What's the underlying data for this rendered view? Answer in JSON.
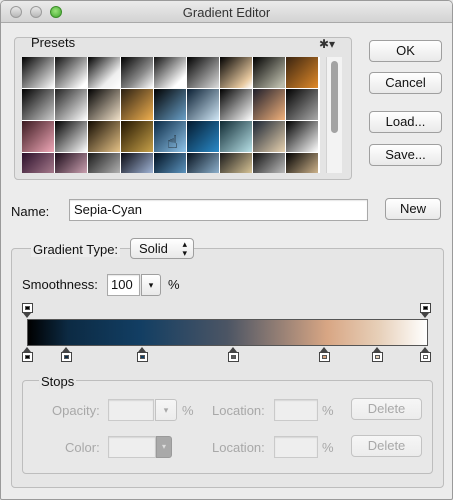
{
  "window": {
    "title": "Gradient Editor"
  },
  "presets": {
    "label": "Presets",
    "menu_icon": "gear-icon",
    "swatches": [
      "linear-gradient(135deg,#000 0%,#fff 100%)",
      "linear-gradient(135deg,#111 0%,#fff 90%)",
      "linear-gradient(135deg,#000 0%,#eee 70%,#fff 100%)",
      "linear-gradient(135deg,#000 0%,#888 60%,#fff 100%)",
      "linear-gradient(135deg,#111 0%,#fff 80%)",
      "linear-gradient(135deg,#000 0%,#ddd 100%)",
      "linear-gradient(135deg,#000 0%,#e8c9a0 80%,#fff 100%)",
      "linear-gradient(135deg,#000 0%,#bba 90%)",
      "linear-gradient(135deg,#3a2410 0%,#e08a2a 100%)",
      "linear-gradient(135deg,#000 0%,#ccc 100%)",
      "linear-gradient(135deg,#222 0%,#fff 100%)",
      "linear-gradient(135deg,#000 0%,#f0e0c8 100%)",
      "linear-gradient(135deg,#2a1f12 0%,#f0b050 100%)",
      "linear-gradient(135deg,#000 0%,#6aa0c8 100%)",
      "linear-gradient(135deg,#0a1f33 0%,#cfe6f5 100%)",
      "linear-gradient(135deg,#000 0%,#ffffff 100%)",
      "linear-gradient(135deg,#1d1d2a 0%,#f2b27c 100%)",
      "linear-gradient(135deg,#000 0%,#aaa 100%)",
      "linear-gradient(135deg,#3b1a20 0%,#f0a8b8 100%)",
      "linear-gradient(135deg,#000 0%,#fff 100%)",
      "linear-gradient(135deg,#120a00 0%,#e5c287 100%)",
      "linear-gradient(135deg,#221500 0%,#c7a14a 100%)",
      "linear-gradient(135deg,#0b2a45 0%,#8fc4ea 100%)",
      "linear-gradient(135deg,#041a2e 0%,#2a8ac8 100%)",
      "linear-gradient(135deg,#0f2a33 0%,#b7e0e6 100%)",
      "linear-gradient(135deg,#1a2433 0%,#e8d2b0 100%)",
      "linear-gradient(135deg,#000 0%,#fff 100%)",
      "linear-gradient(135deg,#2a0f2a 0%,#c090a0 100%)",
      "linear-gradient(135deg,#1a0a18 0%,#f0c0d0 100%)",
      "linear-gradient(135deg,#1a1a1a 0%,#d0d0d0 100%)",
      "linear-gradient(135deg,#0a0a12 0%,#c0d8ff 100%)",
      "linear-gradient(135deg,#001020 0%,#70b0e0 100%)",
      "linear-gradient(135deg,#06121e 0%,#a8d0f0 100%)",
      "linear-gradient(135deg,#1a1a1a 0%,#ffe7b0 100%)",
      "linear-gradient(135deg,#101010 0%,#e0e0e0 100%)",
      "linear-gradient(135deg,#000 0%,#f8d8a8 100%)"
    ]
  },
  "buttons": {
    "ok": "OK",
    "cancel": "Cancel",
    "load": "Load...",
    "save": "Save...",
    "new": "New"
  },
  "name": {
    "label": "Name:",
    "value": "Sepia-Cyan"
  },
  "gradient_type": {
    "label": "Gradient Type:",
    "selected": "Solid",
    "smoothness_label": "Smoothness:",
    "smoothness_value": "100",
    "smoothness_unit": "%"
  },
  "stops": {
    "label": "Stops",
    "opacity_label": "Opacity:",
    "opacity_unit": "%",
    "color_label": "Color:",
    "location_label": "Location:",
    "location_unit": "%",
    "delete_label": "Delete",
    "color_stops": [
      "#000000",
      "#0d2b45",
      "#123e63",
      "#5b5b5b",
      "#d8a684",
      "#e6d4bd",
      "#ffffff"
    ],
    "opacity_stops": [
      "#000000",
      "#000000"
    ]
  },
  "colors": {
    "window_bg": "#ececec",
    "accent": "#123e63"
  }
}
